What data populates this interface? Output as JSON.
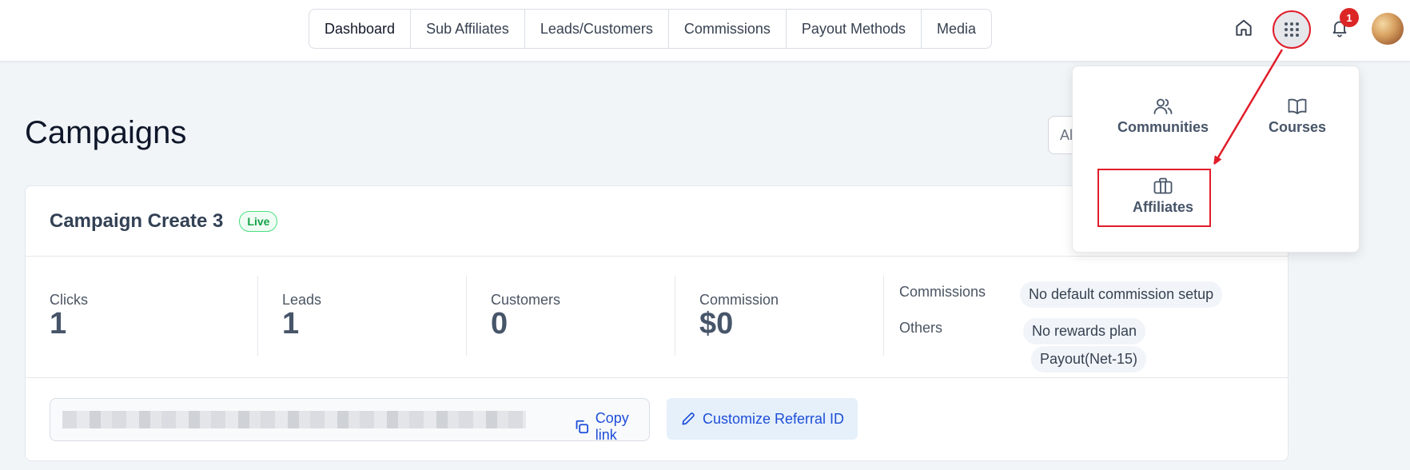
{
  "nav": {
    "tabs": [
      {
        "label": "Dashboard"
      },
      {
        "label": "Sub Affiliates"
      },
      {
        "label": "Leads/Customers"
      },
      {
        "label": "Commissions"
      },
      {
        "label": "Payout Methods"
      },
      {
        "label": "Media"
      }
    ],
    "active_tab": "Dashboard",
    "notification_count": "1"
  },
  "page": {
    "title": "Campaigns",
    "filter_value": "Al"
  },
  "campaign": {
    "name": "Campaign Create 3",
    "status": "Live",
    "stats": [
      {
        "label": "Clicks",
        "value": "1"
      },
      {
        "label": "Leads",
        "value": "1"
      },
      {
        "label": "Customers",
        "value": "0"
      },
      {
        "label": "Commission",
        "value": "$0"
      }
    ],
    "commissions_label": "Commissions",
    "commissions_value": "No default commission setup",
    "others_label": "Others",
    "others_values": [
      "No rewards plan",
      "Payout(Net-15)"
    ],
    "copy_link_label": "Copy link",
    "customize_label": "Customize Referral ID"
  },
  "app_menu": {
    "items": [
      {
        "label": "Communities",
        "icon": "users-icon"
      },
      {
        "label": "Courses",
        "icon": "book-icon"
      },
      {
        "label": "Affiliates",
        "icon": "briefcase-icon"
      }
    ]
  },
  "colors": {
    "accent": "#1d4ed8",
    "annotation": "#e11d2a",
    "live": "#16a34a",
    "badge": "#dc2626"
  }
}
